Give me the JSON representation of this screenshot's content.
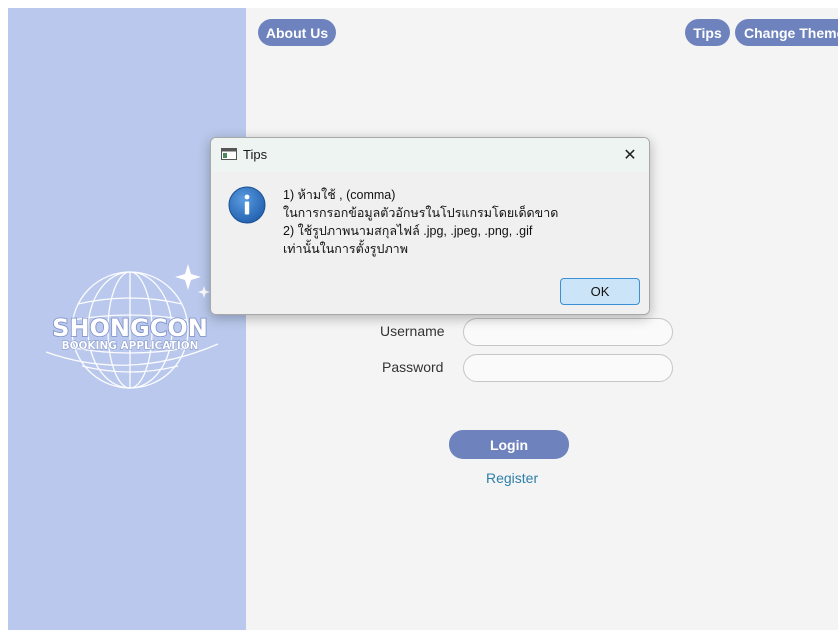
{
  "header": {
    "about_label": "About Us",
    "tips_label": "Tips",
    "theme_label": "Change Theme"
  },
  "logo": {
    "title": "SHONGCON",
    "subtitle": "BOOKING APPLICATION"
  },
  "form": {
    "username_label": "Username",
    "password_label": "Password",
    "username_value": "",
    "password_value": "",
    "login_label": "Login",
    "register_label": "Register"
  },
  "dialog": {
    "title": "Tips",
    "close_glyph": "✕",
    "lines": [
      "1) ห้ามใช้ , (comma)",
      "ในการกรอกข้อมูลตัวอักษรในโปรแกรมโดยเด็ดขาด",
      "2) ใช้รูปภาพนามสกุลไฟล์ .jpg, .jpeg, .png, .gif",
      "เท่านั้นในการตั้งรูปภาพ"
    ],
    "ok_label": "OK",
    "icon": "info-icon"
  },
  "colors": {
    "sidebar": "#b9c8ec",
    "button": "#6e83bd",
    "link": "#2e7fa9",
    "info": "#2f6fbf"
  }
}
